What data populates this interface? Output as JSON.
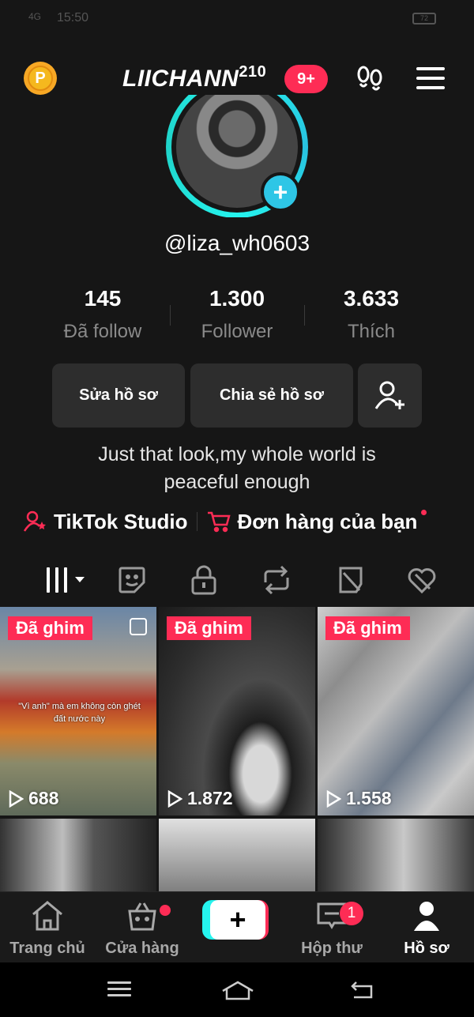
{
  "status_bar": {
    "time": "15:50",
    "signal": "4G",
    "battery": "72"
  },
  "header": {
    "coin_label": "P",
    "username": "LIICHANN",
    "username_sup": "210",
    "notification_badge": "9+"
  },
  "profile": {
    "handle": "@liza_wh0603",
    "stats": [
      {
        "value": "145",
        "label": "Đã follow"
      },
      {
        "value": "1.300",
        "label": "Follower"
      },
      {
        "value": "3.633",
        "label": "Thích"
      }
    ],
    "edit_button": "Sửa hồ sơ",
    "share_button": "Chia sẻ hồ sơ",
    "bio_lines": [
      "Just that look,my whole world is",
      "peaceful enough"
    ],
    "links": {
      "studio": "TikTok Studio",
      "orders": "Đơn hàng của bạn"
    }
  },
  "tabs": [
    "videos-grid-icon",
    "sticker-icon",
    "lock-icon",
    "repost-icon",
    "favorites-icon",
    "liked-icon"
  ],
  "videos": [
    {
      "pinned": "Đã ghim",
      "views": "688",
      "overlay": "\"Vì anh\" mà em không còn ghét đất nước này"
    },
    {
      "pinned": "Đã ghim",
      "views": "1.872"
    },
    {
      "pinned": "Đã ghim",
      "views": "1.558"
    },
    {},
    {},
    {}
  ],
  "bottom_nav": {
    "home": "Trang chủ",
    "shop": "Cửa hàng",
    "create": "+",
    "inbox": "Hộp thư",
    "inbox_count": "1",
    "profile": "Hồ sơ"
  },
  "colors": {
    "accent": "#fe2c55",
    "cyan": "#25f4ee",
    "background": "#161616"
  }
}
